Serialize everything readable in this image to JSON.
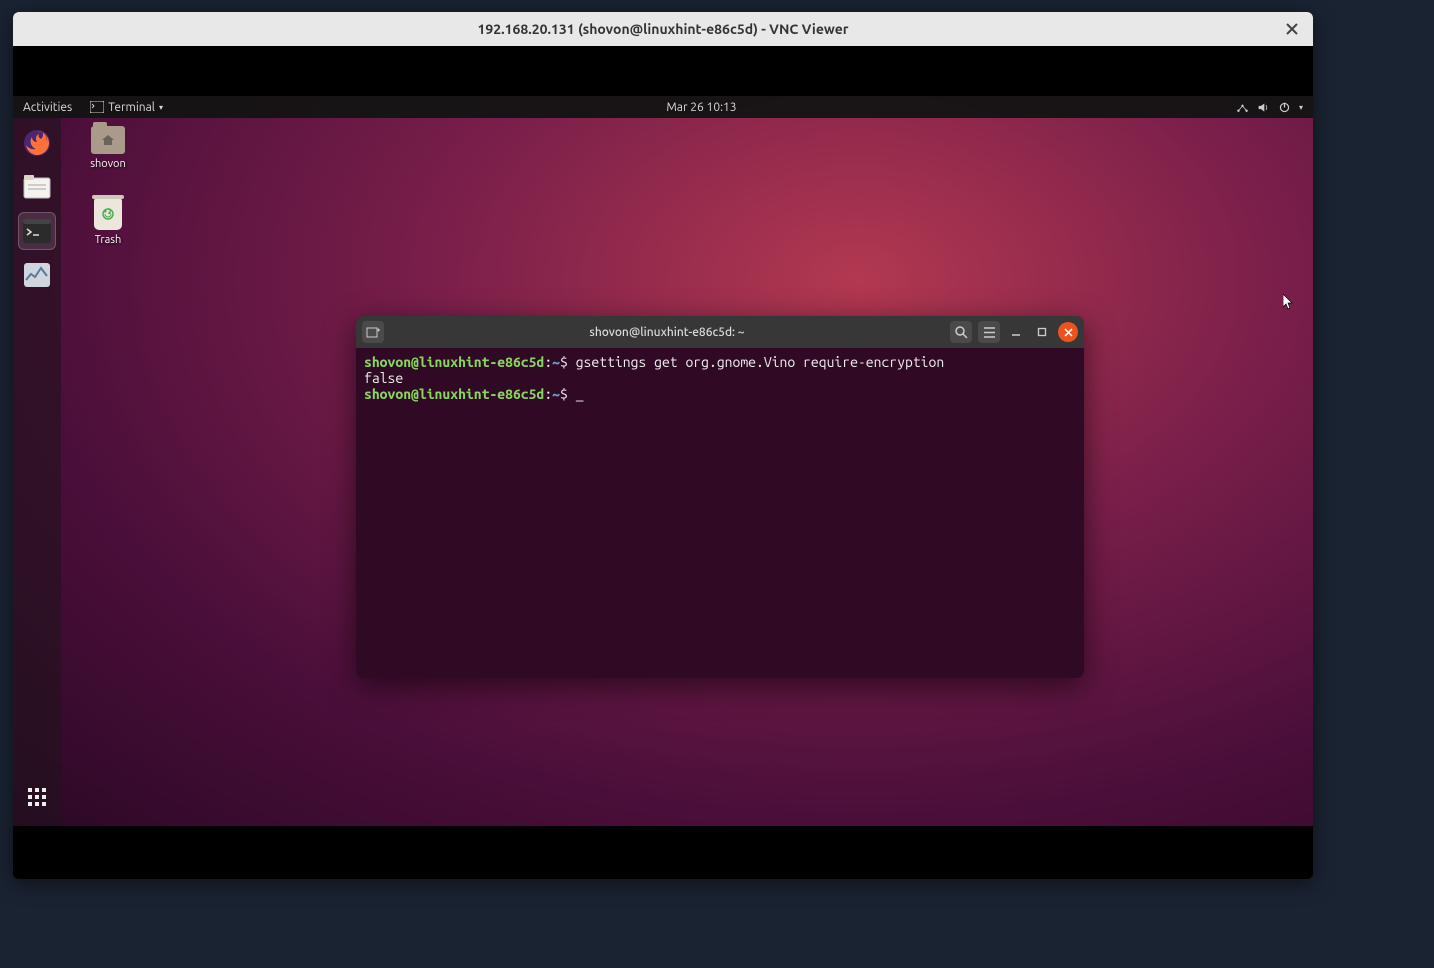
{
  "vnc": {
    "title": "192.168.20.131 (shovon@linuxhint-e86c5d) - VNC Viewer"
  },
  "panel": {
    "activities": "Activities",
    "app_label": "Terminal",
    "datetime": "Mar 26  10:13"
  },
  "desktop": {
    "home_label": "shovon",
    "trash_label": "Trash"
  },
  "terminal": {
    "title": "shovon@linuxhint-e86c5d: ~",
    "line1_user": "shovon@linuxhint-e86c5d",
    "line1_sep": ":",
    "line1_path": "~",
    "line1_dollar": "$ ",
    "line1_cmd": "gsettings get org.gnome.Vino require-encryption",
    "line2_output": "false",
    "line3_user": "shovon@linuxhint-e86c5d",
    "line3_sep": ":",
    "line3_path": "~",
    "line3_dollar": "$ "
  }
}
